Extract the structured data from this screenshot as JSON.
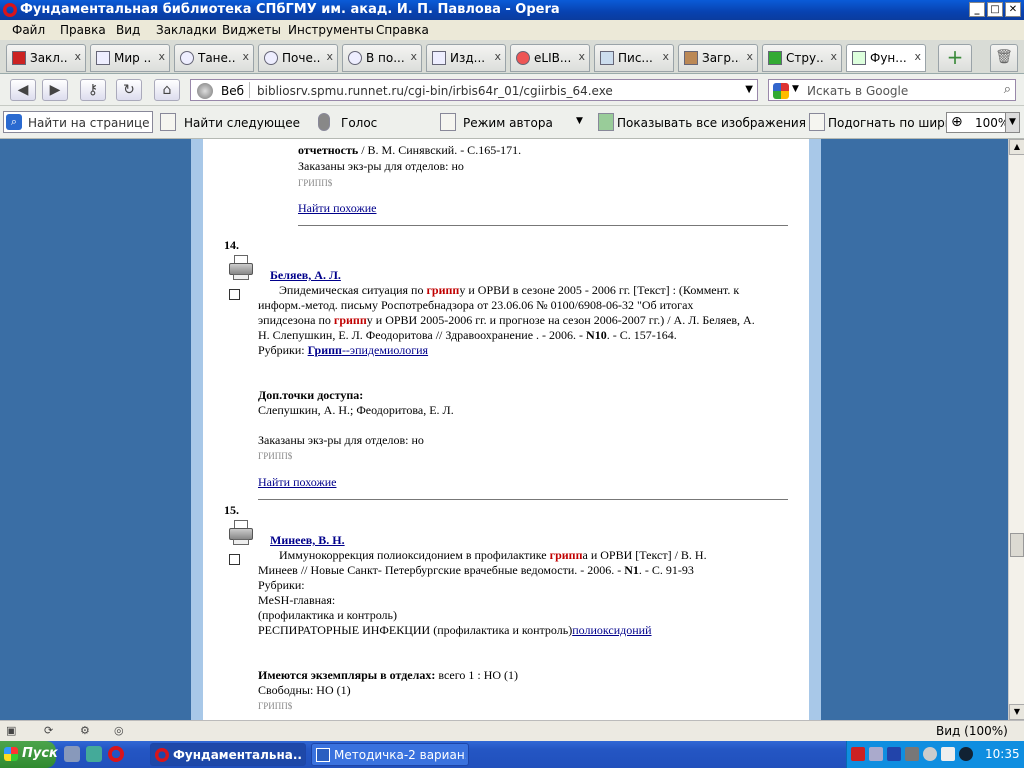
{
  "window": {
    "title": "Фундаментальная библиотека СПбГМУ им. акад. И. П. Павлова - Opera",
    "controls": {
      "minimize": "_",
      "maximize": "□",
      "close": "✕"
    }
  },
  "menu": [
    "Файл",
    "Правка",
    "Вид",
    "Закладки",
    "Виджеты",
    "Инструменты",
    "Справка"
  ],
  "tabs": [
    {
      "label": "Закл..."
    },
    {
      "label": "Мир ..."
    },
    {
      "label": "Тане..."
    },
    {
      "label": "Поче..."
    },
    {
      "label": "В по..."
    },
    {
      "label": "Изд..."
    },
    {
      "label": "eLIB..."
    },
    {
      "label": "Пис..."
    },
    {
      "label": "Загр..."
    },
    {
      "label": "Стру..."
    },
    {
      "label": "Фун..."
    }
  ],
  "address": {
    "web_label": "Веб",
    "url": "bibliosrv.spmu.runnet.ru/cgi-bin/irbis64r_01/cgiirbis_64.exe",
    "search_placeholder": "Искать в Google"
  },
  "findbar": {
    "find_placeholder": "Найти на странице",
    "find_next": "Найти следующее",
    "voice": "Голос",
    "author_mode": "Режим автора",
    "show_images": "Показывать все изображения",
    "fit_width": "Подогнать по ширине",
    "zoom": "100%"
  },
  "results": {
    "top_fragment": {
      "author_line_bold": "отчетность",
      "author_line_rest": " / В. М. Синявский. - С.165-171.",
      "ordered": "Заказаны экз-ры для отделов: но",
      "code": "ГРИПП$",
      "similar": "Найти похожие"
    },
    "r14": {
      "num": "14.",
      "author": "Беляев, А. Л.",
      "l1_a": "Эпидемическая ситуация по ",
      "l1_hl": "грипп",
      "l1_b": "у и ОРВИ в сезоне 2005 - 2006 гг. [Текст] : (Коммент. к",
      "l2": "информ.-метод. письму Роспотребнадзора от 23.06.06 № 0100/6908-06-32 \"Об итогах",
      "l3_a": "эпидсезона по ",
      "l3_hl": "грипп",
      "l3_b": "у и ОРВИ 2005-2006 гг. и прогнозе на сезон 2006-2007 гг.) / А. Л. Беляев, А.",
      "l4_a": "Н. Слепушкин, Е. Л. Феодоритова // Здравоохранение . - 2006. - ",
      "l4_bold": "N10",
      "l4_b": ". - С. 157-164.",
      "rubric_label": "Рубрики: ",
      "rubric_hl": "Грипп",
      "rubric_link": "--эпидемиология",
      "access_label": "Доп.точки доступа:",
      "access_value": "Слепушкин, А. Н.; Феодоритова, Е. Л.",
      "ordered": "Заказаны экз-ры для отделов: но",
      "code": "ГРИПП$",
      "similar": "Найти похожие"
    },
    "r15": {
      "num": "15.",
      "author": "Минеев, В. Н.",
      "l1_a": "Иммунокоррекция полиоксидонием в профилактике ",
      "l1_hl": "грипп",
      "l1_b": "а и ОРВИ [Текст] / В. Н.",
      "l2_a": "Минеев // Новые Санкт- Петербургские врачебные ведомости. - 2006. - ",
      "l2_bold": "N1",
      "l2_b": ". - С. 91-93",
      "rubric_label": "Рубрики:",
      "mesh": "MeSH-главная:",
      "prof": "(профилактика и контроль)",
      "resp_text": "РЕСПИРАТОРНЫЕ ИНФЕКЦИИ (профилактика и контроль)",
      "resp_link": "полиоксидоний",
      "holdings_label": "Имеются экземпляры в отделах:",
      "holdings_value": " всего 1 : НО (1)",
      "free": "Свободны: НО (1)",
      "code": "ГРИПП$"
    }
  },
  "statusbar": {
    "zoom": "Вид (100%)"
  },
  "taskbar": {
    "start": "Пуск",
    "items": [
      {
        "label": "Фундаментальна..."
      },
      {
        "label": "Методичка-2 вариан..."
      }
    ],
    "clock": "10:35"
  },
  "colors": {
    "accent": "#0842b0",
    "highlight": "#c00000",
    "link": "#00008b",
    "desktop": "#3a6ea5"
  }
}
